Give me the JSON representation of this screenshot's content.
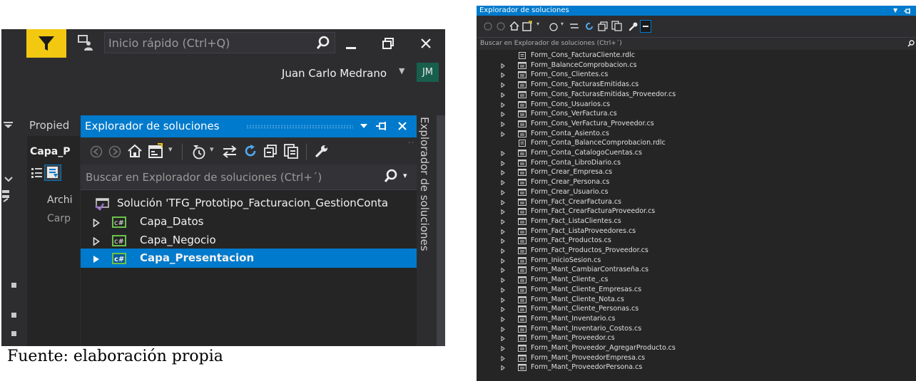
{
  "left": {
    "quick_launch_placeholder": "Inicio rápido (Ctrl+Q)",
    "user_name": "Juan Carlo Medrano",
    "user_initials": "JM",
    "properties_tab": "Propied",
    "properties_object": "Capa_P",
    "properties_archi": "Archi",
    "properties_carp": "Carp",
    "se_title": "Explorador de soluciones",
    "se_search_placeholder": "Buscar en Explorador de soluciones (Ctrl+´)",
    "solution_label": "Solución 'TFG_Prototipo_Facturacion_GestionConta",
    "projects": [
      {
        "label": "Capa_Datos",
        "selected": false
      },
      {
        "label": "Capa_Negocio",
        "selected": false
      },
      {
        "label": "Capa_Presentacion",
        "selected": true
      }
    ],
    "side_tab": "Explorador de soluciones",
    "colors": {
      "accent": "#007acc",
      "filter": "#f2c811",
      "avatar": "#185e4d",
      "background": "#2d2d30"
    }
  },
  "caption": "Fuente: elaboración propia",
  "right": {
    "title": "Explorador de soluciones",
    "search_placeholder": "Buscar en Explorador de soluciones (Ctrl+´)",
    "files": [
      {
        "name": "Form_Cons_FacturaCliente.rdlc",
        "expandable": false,
        "kind": "report"
      },
      {
        "name": "Form_BalanceComprobacion.cs",
        "expandable": true,
        "kind": "form"
      },
      {
        "name": "Form_Cons_Clientes.cs",
        "expandable": true,
        "kind": "form"
      },
      {
        "name": "Form_Cons_FacturasEmitidas.cs",
        "expandable": true,
        "kind": "form"
      },
      {
        "name": "Form_Cons_FacturasEmitidas_Proveedor.cs",
        "expandable": true,
        "kind": "form"
      },
      {
        "name": "Form_Cons_Usuarios.cs",
        "expandable": true,
        "kind": "form"
      },
      {
        "name": "Form_Cons_VerFactura.cs",
        "expandable": true,
        "kind": "form"
      },
      {
        "name": "Form_Cons_VerFactura_Proveedor.cs",
        "expandable": true,
        "kind": "form"
      },
      {
        "name": "Form_Conta_Asiento.cs",
        "expandable": true,
        "kind": "form"
      },
      {
        "name": "Form_Conta_BalanceComprobacion.rdlc",
        "expandable": false,
        "kind": "report"
      },
      {
        "name": "Form_Conta_CatalogoCuentas.cs",
        "expandable": true,
        "kind": "form"
      },
      {
        "name": "Form_Conta_LibroDiario.cs",
        "expandable": true,
        "kind": "form"
      },
      {
        "name": "Form_Crear_Empresa.cs",
        "expandable": true,
        "kind": "form"
      },
      {
        "name": "Form_Crear_Persona.cs",
        "expandable": true,
        "kind": "form"
      },
      {
        "name": "Form_Crear_Usuario.cs",
        "expandable": true,
        "kind": "form"
      },
      {
        "name": "Form_Fact_CrearFactura.cs",
        "expandable": true,
        "kind": "form"
      },
      {
        "name": "Form_Fact_CrearFacturaProveedor.cs",
        "expandable": true,
        "kind": "form"
      },
      {
        "name": "Form_Fact_ListaClientes.cs",
        "expandable": true,
        "kind": "form"
      },
      {
        "name": "Form_Fact_ListaProveedores.cs",
        "expandable": true,
        "kind": "form"
      },
      {
        "name": "Form_Fact_Productos.cs",
        "expandable": true,
        "kind": "form"
      },
      {
        "name": "Form_Fact_Productos_Proveedor.cs",
        "expandable": true,
        "kind": "form"
      },
      {
        "name": "Form_InicioSesion.cs",
        "expandable": true,
        "kind": "form"
      },
      {
        "name": "Form_Mant_CambiarContraseña.cs",
        "expandable": true,
        "kind": "form"
      },
      {
        "name": "Form_Mant_Cliente_.cs",
        "expandable": true,
        "kind": "form"
      },
      {
        "name": "Form_Mant_Cliente_Empresas.cs",
        "expandable": true,
        "kind": "form"
      },
      {
        "name": "Form_Mant_Cliente_Nota.cs",
        "expandable": true,
        "kind": "form"
      },
      {
        "name": "Form_Mant_Cliente_Personas.cs",
        "expandable": true,
        "kind": "form"
      },
      {
        "name": "Form_Mant_Inventario.cs",
        "expandable": true,
        "kind": "form"
      },
      {
        "name": "Form_Mant_Inventario_Costos.cs",
        "expandable": true,
        "kind": "form"
      },
      {
        "name": "Form_Mant_Proveedor.cs",
        "expandable": true,
        "kind": "form"
      },
      {
        "name": "Form_Mant_Proveedor_AgregarProducto.cs",
        "expandable": true,
        "kind": "form"
      },
      {
        "name": "Form_Mant_ProveedorEmpresa.cs",
        "expandable": true,
        "kind": "form"
      },
      {
        "name": "Form_Mant_ProveedorPersona.cs",
        "expandable": true,
        "kind": "form"
      }
    ]
  }
}
